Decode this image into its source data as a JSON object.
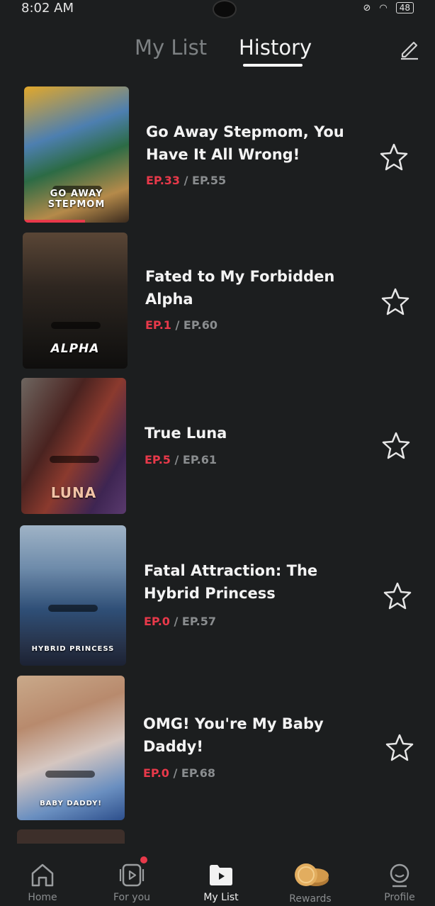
{
  "status": {
    "time": "8:02 AM",
    "battery": "48"
  },
  "tabs": {
    "my_list": "My List",
    "history": "History"
  },
  "items": [
    {
      "title_line1": "Go Away Stepmom, You",
      "title_line2": "Have It All Wrong!",
      "ep_current": "EP.33",
      "ep_total": "EP.55",
      "thumb_caption": "GO AWAY STEPMOM",
      "progress": 0.6
    },
    {
      "title_line1": "Fated to My Forbidden",
      "title_line2": "Alpha",
      "ep_current": "EP.1",
      "ep_total": "EP.60",
      "thumb_caption": "ALPHA",
      "progress": 0.0
    },
    {
      "title_line1": "True Luna",
      "title_line2": "",
      "ep_current": "EP.5",
      "ep_total": "EP.61",
      "thumb_caption": "LUNA",
      "progress": 0.0
    },
    {
      "title_line1": "Fatal Attraction: The",
      "title_line2": "Hybrid Princess",
      "ep_current": "EP.0",
      "ep_total": "EP.57",
      "thumb_caption": "HYBRID PRINCESS",
      "progress": 0.0
    },
    {
      "title_line1": "OMG! You're My Baby",
      "title_line2": "Daddy!",
      "ep_current": "EP.0",
      "ep_total": "EP.68",
      "thumb_caption": "BABY DADDY!",
      "progress": 0.0
    }
  ],
  "nav": {
    "home": "Home",
    "for_you": "For you",
    "my_list": "My List",
    "rewards": "Rewards",
    "profile": "Profile"
  },
  "colors": {
    "accent": "#e8394a",
    "background": "#1c1e1f",
    "muted": "#8a8d8f"
  }
}
